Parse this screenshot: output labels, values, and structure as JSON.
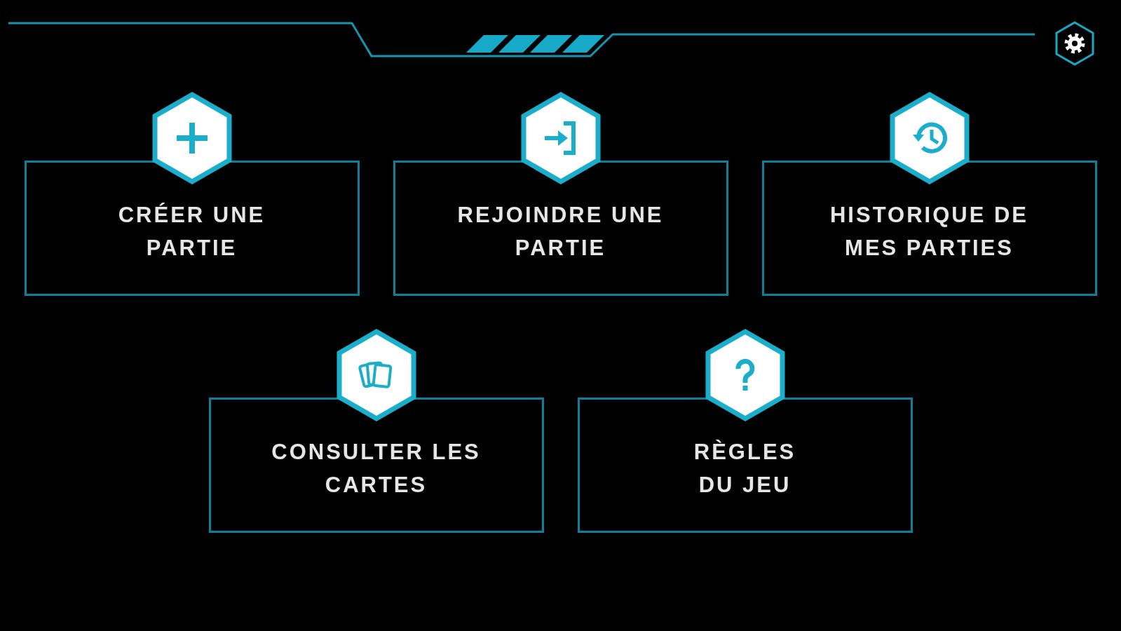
{
  "menu": {
    "rows": [
      {
        "items": [
          {
            "kind": "create",
            "lines": [
              "CRÉER UNE",
              "PARTIE"
            ]
          },
          {
            "kind": "join",
            "lines": [
              "REJOINDRE UNE",
              "PARTIE"
            ]
          },
          {
            "kind": "history",
            "lines": [
              "HISTORIQUE DE",
              "MES PARTIES"
            ]
          }
        ]
      },
      {
        "items": [
          {
            "kind": "cards",
            "lines": [
              "CONSULTER LES",
              "CARTES"
            ]
          },
          {
            "kind": "rules",
            "lines": [
              "RÈGLES",
              "DU JEU"
            ]
          }
        ]
      }
    ]
  }
}
